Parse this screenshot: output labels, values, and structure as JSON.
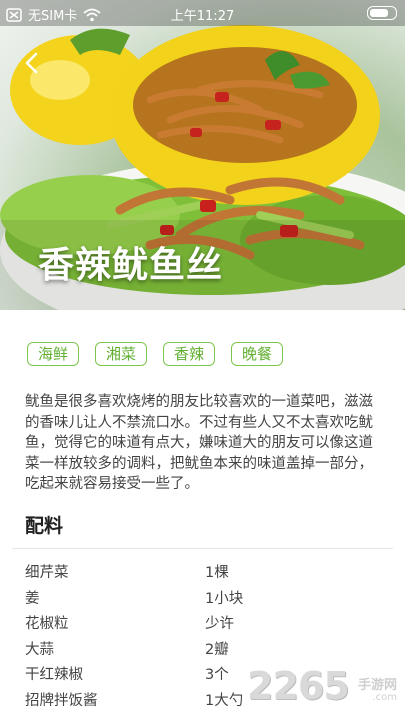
{
  "status_bar": {
    "carrier": "无SIM卡",
    "time": "上午11:27"
  },
  "recipe": {
    "title": "香辣鱿鱼丝",
    "tags": [
      "海鲜",
      "湘菜",
      "香辣",
      "晚餐"
    ],
    "description": "鱿鱼是很多喜欢烧烤的朋友比较喜欢的一道菜吧，滋滋的香味儿让人不禁流口水。不过有些人又不太喜欢吃鱿鱼，觉得它的味道有点大，嫌味道大的朋友可以像这道菜一样放较多的调料，把鱿鱼本来的味道盖掉一部分，吃起来就容易接受一些了。",
    "ingredients_title": "配料",
    "ingredients": [
      {
        "name": "细芹菜",
        "qty": "1棵"
      },
      {
        "name": "姜",
        "qty": "1小块"
      },
      {
        "name": "花椒粒",
        "qty": "少许"
      },
      {
        "name": "大蒜",
        "qty": "2瓣"
      },
      {
        "name": "干红辣椒",
        "qty": "3个"
      },
      {
        "name": "招牌拌饭酱",
        "qty": "1大勺"
      }
    ]
  },
  "watermark": {
    "number": "2265",
    "suffix": ".com",
    "label": "手游网"
  },
  "colors": {
    "tag_green": "#7fc650",
    "pepper_yellow": "#f2d21a"
  }
}
